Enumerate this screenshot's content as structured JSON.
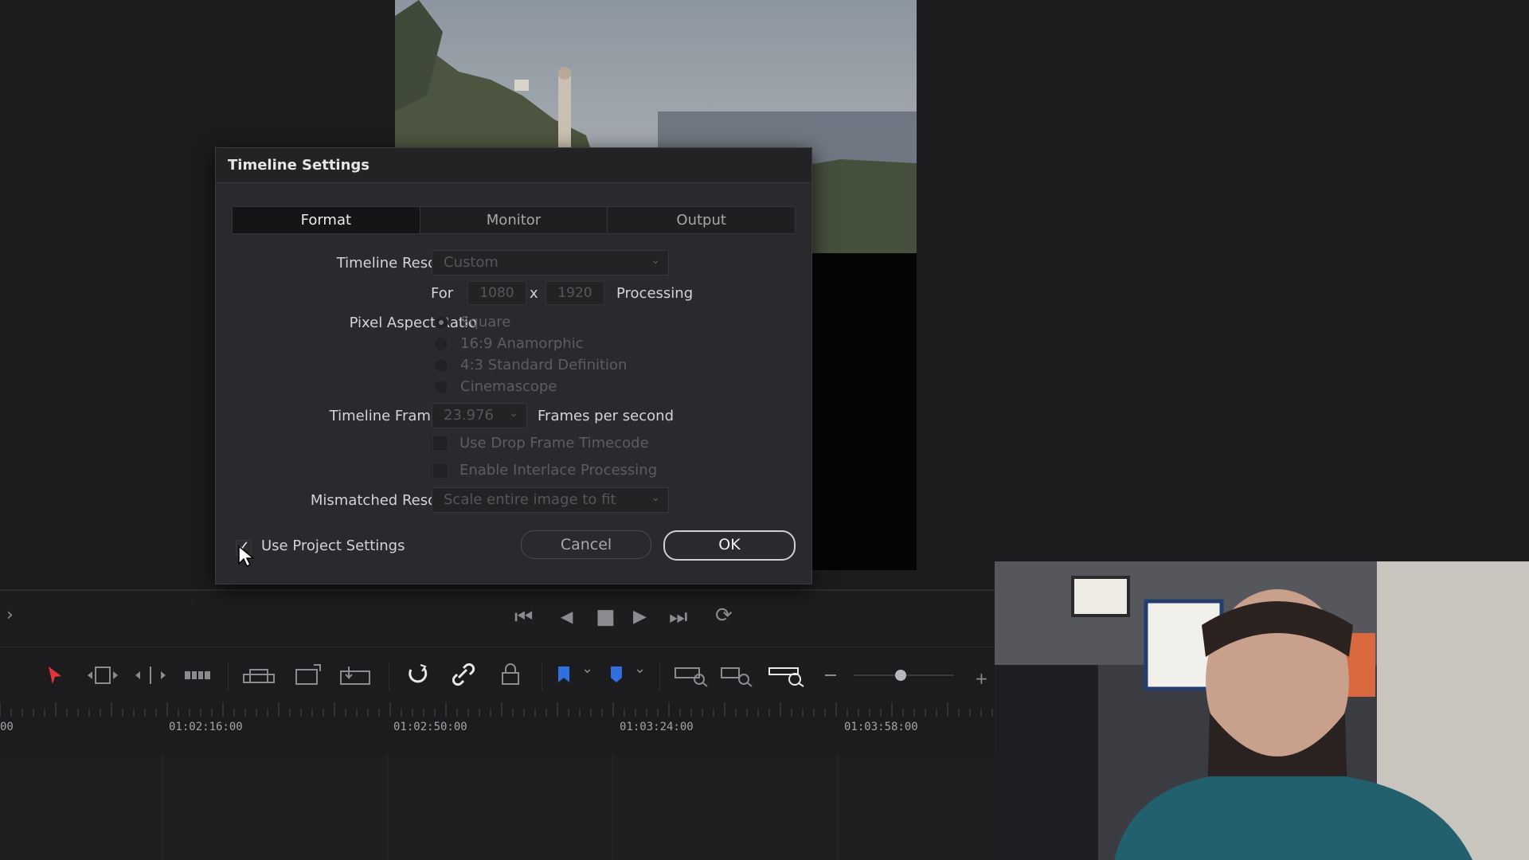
{
  "dialog": {
    "title": "Timeline Settings",
    "tabs": [
      {
        "label": "Format",
        "active": true
      },
      {
        "label": "Monitor",
        "active": false
      },
      {
        "label": "Output",
        "active": false
      }
    ],
    "timeline_resolution": {
      "label": "Timeline Resolution",
      "value": "Custom"
    },
    "for_label": "For",
    "width_value": "1080",
    "x_label": "x",
    "height_value": "1920",
    "processing_label": "Processing",
    "pixel_aspect": {
      "label": "Pixel Aspect Ratio",
      "options": [
        "Square",
        "16:9 Anamorphic",
        "4:3 Standard Definition",
        "Cinemascope"
      ],
      "selected": "Square"
    },
    "frame_rate": {
      "label": "Timeline Frame Rate",
      "value": "23.976",
      "unit": "Frames per second"
    },
    "drop_frame_label": "Use Drop Frame Timecode",
    "interlace_label": "Enable Interlace Processing",
    "mismatched": {
      "label": "Mismatched Resolution",
      "value": "Scale entire image to fit"
    },
    "use_project_settings": {
      "label": "Use Project Settings",
      "checked": true
    },
    "cancel_label": "Cancel",
    "ok_label": "OK"
  },
  "icons": {
    "jump_start": "⏮",
    "prev_frame": "◀",
    "stop": "■",
    "play": "▶",
    "jump_end": "⏭",
    "loop": "⟳",
    "expand": "›",
    "check": "✓",
    "chevron": "⌄"
  },
  "ruler": {
    "timecodes": [
      "00",
      "01:02:16:00",
      "01:02:50:00",
      "01:03:24:00",
      "01:03:58:00"
    ]
  },
  "colors": {
    "accent_red": "#e0353a",
    "accent_blue": "#2f6fe0"
  }
}
